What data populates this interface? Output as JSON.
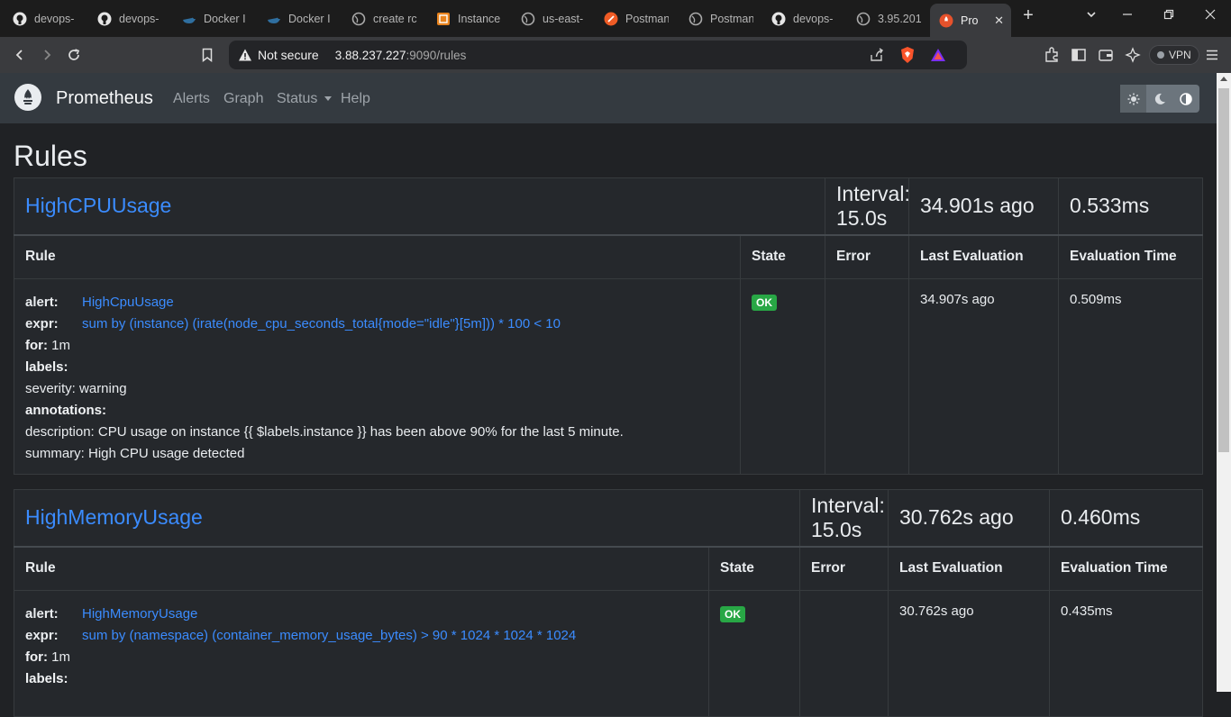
{
  "browser": {
    "tabs": [
      {
        "label": "devops-",
        "icon": "github-icon"
      },
      {
        "label": "devops-",
        "icon": "github-icon"
      },
      {
        "label": "Docker I",
        "icon": "docker-icon"
      },
      {
        "label": "Docker I",
        "icon": "docker-icon"
      },
      {
        "label": "create rc",
        "icon": "globe-icon"
      },
      {
        "label": "Instance",
        "icon": "aws-icon"
      },
      {
        "label": "us-east-",
        "icon": "globe-icon"
      },
      {
        "label": "Postman",
        "icon": "postman-icon"
      },
      {
        "label": "Postman",
        "icon": "globe-icon"
      },
      {
        "label": "devops-",
        "icon": "github-icon"
      },
      {
        "label": "3.95.201",
        "icon": "globe-icon"
      },
      {
        "label": "Pro",
        "icon": "prometheus-icon",
        "active": true
      }
    ],
    "url_security": "Not secure",
    "url_host": "3.88.237.227",
    "url_path": ":9090/rules",
    "vpn_label": "VPN"
  },
  "nav": {
    "brand": "Prometheus",
    "links": [
      "Alerts",
      "Graph",
      "Status",
      "Help"
    ]
  },
  "page": {
    "title": "Rules"
  },
  "rule_groups": [
    {
      "name": "HighCPUUsage",
      "interval": "Interval: 15.0s",
      "last_eval": "34.901s ago",
      "eval_time": "0.533ms",
      "headers": [
        "Rule",
        "State",
        "Error",
        "Last Evaluation",
        "Evaluation Time"
      ],
      "rule": {
        "alert_key": "alert:",
        "alert": "HighCpuUsage",
        "expr_key": "expr:",
        "expr": "sum by (instance) (irate(node_cpu_seconds_total{mode=\"idle\"}[5m])) * 100 < 10",
        "for_key": "for:",
        "for": "1m",
        "labels_key": "labels:",
        "labels": [
          "severity: warning"
        ],
        "annotations_key": "annotations:",
        "annotations": [
          "description: CPU usage on instance {{ $labels.instance }} has been above 90% for the last 5 minute.",
          "summary: High CPU usage detected"
        ],
        "state": "OK",
        "error": "",
        "last_eval": "34.907s ago",
        "eval_time": "0.509ms"
      }
    },
    {
      "name": "HighMemoryUsage",
      "interval": "Interval: 15.0s",
      "last_eval": "30.762s ago",
      "eval_time": "0.460ms",
      "headers": [
        "Rule",
        "State",
        "Error",
        "Last Evaluation",
        "Evaluation Time"
      ],
      "rule": {
        "alert_key": "alert:",
        "alert": "HighMemoryUsage",
        "expr_key": "expr:",
        "expr": "sum by (namespace) (container_memory_usage_bytes) > 90 * 1024 * 1024 * 1024",
        "for_key": "for:",
        "for": "1m",
        "labels_key": "labels:",
        "state": "OK",
        "error": "",
        "last_eval": "30.762s ago",
        "eval_time": "0.435ms"
      }
    }
  ]
}
